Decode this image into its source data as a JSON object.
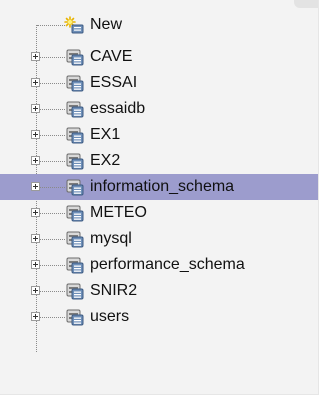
{
  "tree": {
    "new_item": {
      "label": "New",
      "icon": "new-database-icon"
    },
    "databases": [
      {
        "label": "CAVE",
        "icon": "database-icon",
        "selected": false
      },
      {
        "label": "ESSAI",
        "icon": "database-icon",
        "selected": false
      },
      {
        "label": "essaidb",
        "icon": "database-icon",
        "selected": false
      },
      {
        "label": "EX1",
        "icon": "database-icon",
        "selected": false
      },
      {
        "label": "EX2",
        "icon": "database-icon",
        "selected": false
      },
      {
        "label": "information_schema",
        "icon": "database-icon",
        "selected": true
      },
      {
        "label": "METEO",
        "icon": "database-icon",
        "selected": false
      },
      {
        "label": "mysql",
        "icon": "database-icon",
        "selected": false
      },
      {
        "label": "performance_schema",
        "icon": "database-icon",
        "selected": false
      },
      {
        "label": "SNIR2",
        "icon": "database-icon",
        "selected": false
      },
      {
        "label": "users",
        "icon": "database-icon",
        "selected": false
      }
    ]
  },
  "colors": {
    "selected_row": "#9c9ccd",
    "panel_background": "#f3f3f3"
  }
}
